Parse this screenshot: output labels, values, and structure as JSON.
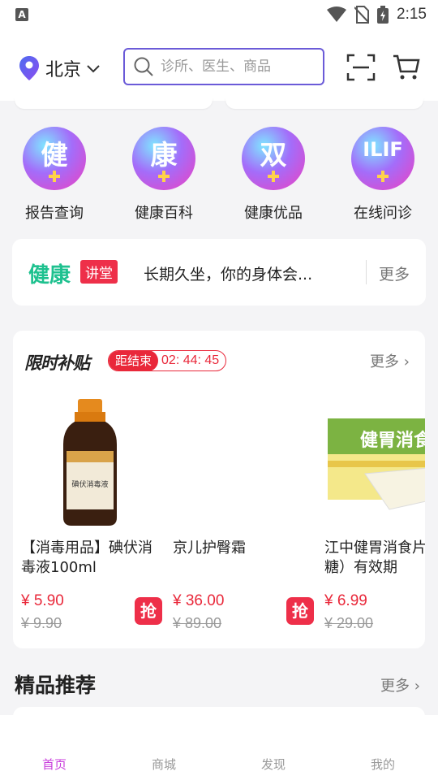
{
  "status_bar": {
    "time": "2:15",
    "app_icon": "A"
  },
  "header": {
    "location": "北京",
    "search_placeholder": "诊所、医生、商品"
  },
  "quick_entries": [
    {
      "glyph": "健",
      "label": "报告查询"
    },
    {
      "glyph": "康",
      "label": "健康百科"
    },
    {
      "glyph": "双",
      "label": "健康优品"
    },
    {
      "glyph": "ILIF",
      "label": "在线问诊"
    }
  ],
  "lecture": {
    "logo": "健康",
    "tag": "讲堂",
    "headline": "长期久坐，你的身体会...",
    "more": "更多"
  },
  "flash_sale": {
    "title": "限时补贴",
    "countdown_label": "距结束",
    "countdown_value": "02: 44: 45",
    "more": "更多 ›",
    "products": [
      {
        "name": "【消毒用品】碘伏消毒液100ml",
        "price": "¥ 5.90",
        "old_price": "¥ 9.90",
        "grab": "抢",
        "image_label": "碘伏消毒液"
      },
      {
        "name": "京儿护臀霜",
        "price": "¥ 36.00",
        "old_price": "¥ 89.00",
        "grab": "抢"
      },
      {
        "name": "江中健胃消食片（无糖）有效期",
        "price": "¥ 6.99",
        "old_price": "¥ 29.00",
        "image_label": "健胃消食片"
      }
    ]
  },
  "recommend": {
    "title": "精品推荐",
    "more": "更多 ›"
  },
  "tabbar": [
    {
      "label": "首页",
      "active": true
    },
    {
      "label": "商城",
      "active": false
    },
    {
      "label": "发现",
      "active": false
    },
    {
      "label": "我的",
      "active": false
    }
  ],
  "colors": {
    "accent": "#6b5bd8",
    "red": "#e9283a",
    "green": "#1ec18f",
    "tab_active": "#c83cdc"
  }
}
